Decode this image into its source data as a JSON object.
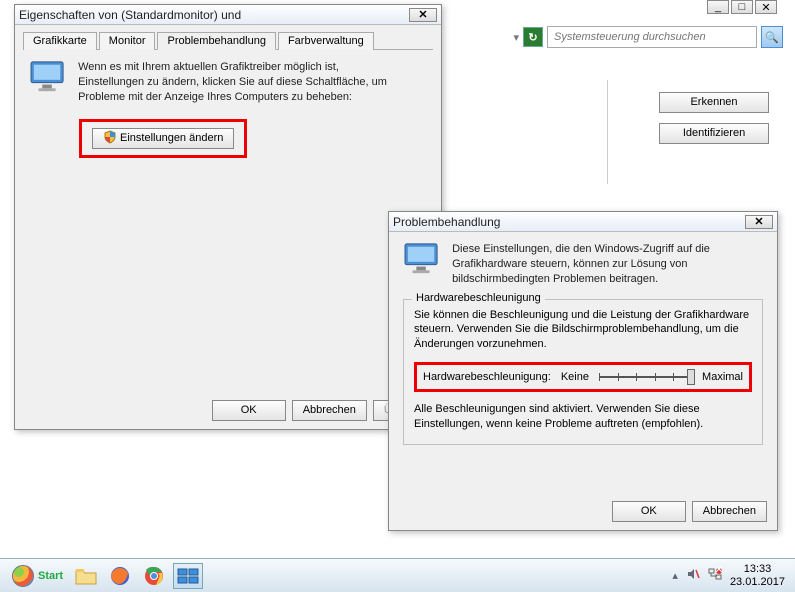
{
  "bg": {
    "search_placeholder": "Systemsteuerung durchsuchen",
    "btn_detect": "Erkennen",
    "btn_identify": "Identifizieren"
  },
  "win1": {
    "title": "Eigenschaften von (Standardmonitor) und",
    "tabs": [
      "Grafikkarte",
      "Monitor",
      "Problembehandlung",
      "Farbverwaltung"
    ],
    "active_tab": 2,
    "desc": "Wenn es mit Ihrem aktuellen Grafiktreiber möglich ist, Einstellungen zu ändern, klicken Sie auf diese Schaltfläche, um Probleme mit der Anzeige Ihres Computers zu beheben:",
    "change_btn": "Einstellungen ändern",
    "ok": "OK",
    "cancel": "Abbrechen",
    "apply": "Überne"
  },
  "win2": {
    "title": "Problembehandlung",
    "intro": "Diese Einstellungen, die den Windows-Zugriff auf die Grafikhardware steuern, können zur Lösung von bildschirmbedingten Problemen beitragen.",
    "fieldset_title": "Hardwarebeschleunigung",
    "fieldset_desc": "Sie können die Beschleunigung und die Leistung der Grafikhardware steuern. Verwenden Sie die Bildschirmproblembehandlung, um die Änderungen vorzunehmen.",
    "slider_label": "Hardwarebeschleunigung:",
    "slider_min": "Keine",
    "slider_max": "Maximal",
    "note": "Alle Beschleunigungen sind aktiviert. Verwenden Sie diese Einstellungen, wenn keine Probleme auftreten (empfohlen).",
    "ok": "OK",
    "cancel": "Abbrechen"
  },
  "taskbar": {
    "start": "Start",
    "time": "13:33",
    "date": "23.01.2017"
  }
}
